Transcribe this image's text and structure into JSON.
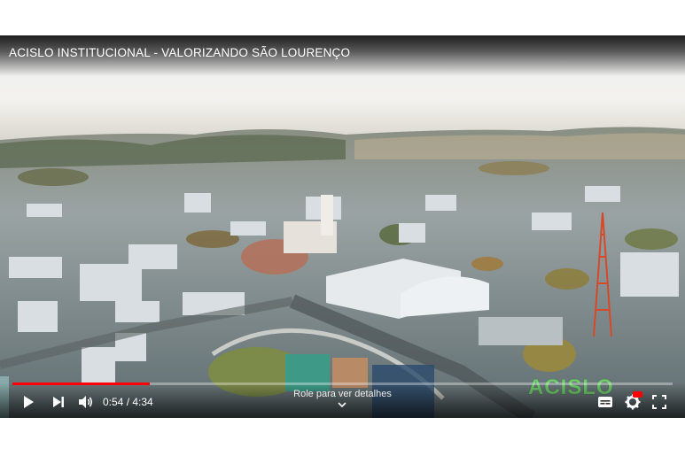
{
  "player": {
    "title": "ACISLO INSTITUCIONAL - VALORIZANDO SÃO LOURENÇO",
    "progress_fraction": 0.208,
    "current_time": "0:54",
    "duration": "4:34",
    "time_display": "0:54 / 4:34",
    "scroll_hint": "Role para ver detalhes",
    "watermark": "ACISLO",
    "accent_color": "#ff0000"
  },
  "icons": {
    "play": "play-icon",
    "next": "next-icon",
    "volume": "volume-icon",
    "subtitles": "subtitles-icon",
    "settings": "settings-gear-icon",
    "fullscreen": "fullscreen-icon",
    "chevron": "chevron-down-icon"
  }
}
